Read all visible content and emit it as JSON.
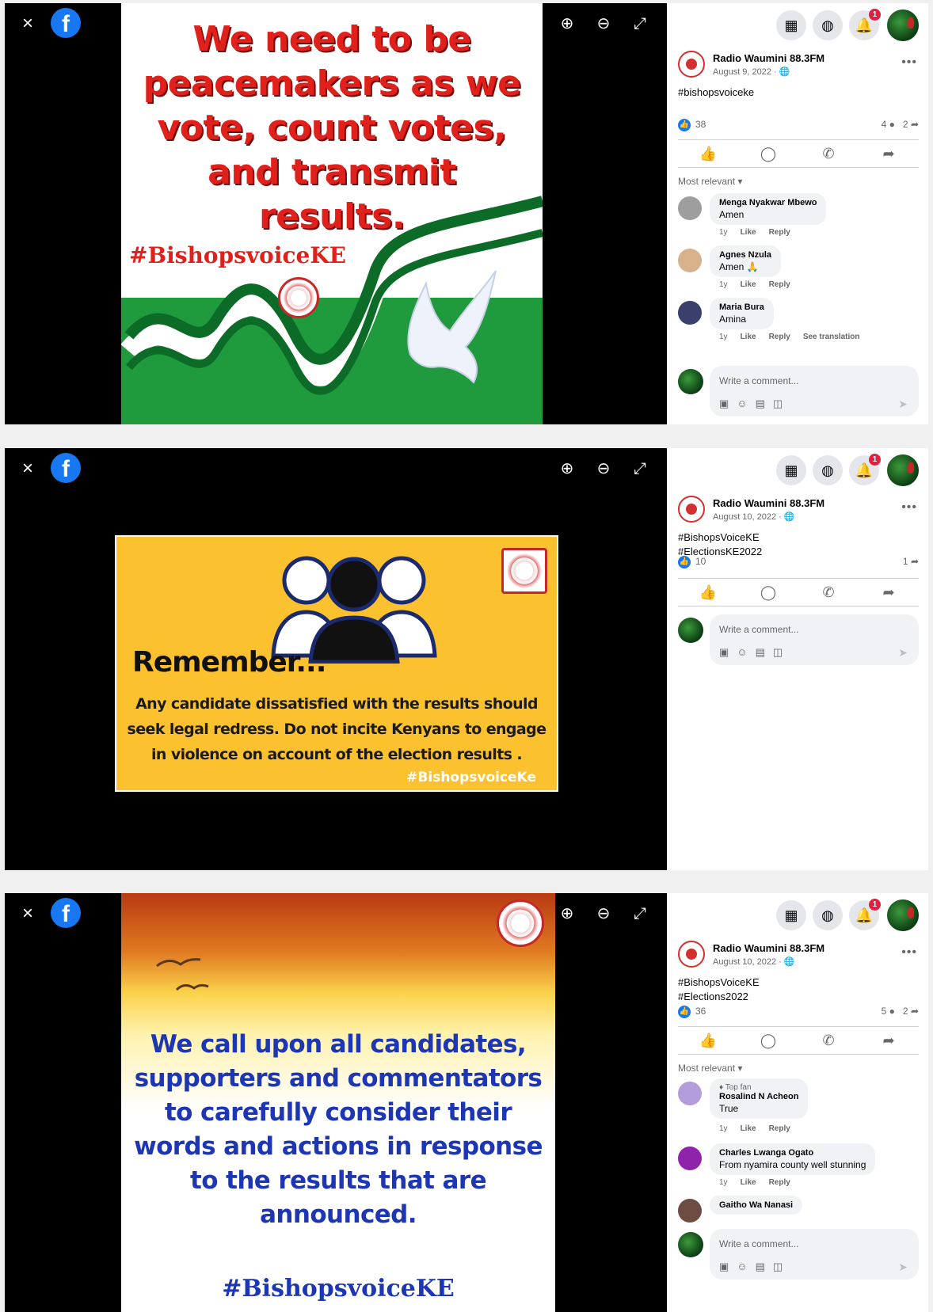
{
  "common": {
    "close_glyph": "×",
    "fb_logo": "f",
    "zoom_in_icon": "zoom-in-icon",
    "zoom_out_icon": "zoom-out-icon",
    "fullscreen_icon": "fullscreen-icon",
    "notification_count": "1",
    "page_name": "Radio Waumini 88.3FM",
    "reply_label": "Reply",
    "like_label": "Like",
    "comment_placeholder": "Write a comment...",
    "brand_blue": "#1877f2"
  },
  "posts": [
    {
      "image_text": "We need to be peacemakers as we vote, count votes, and transmit results.",
      "image_hashtag": "#BishopsvoiceKE",
      "date": "August 9, 2022 · ",
      "caption": "#bishopsvoiceke",
      "likes": "38",
      "comments_count": "4",
      "shares_count": "2",
      "sort_label": "Most relevant ▾",
      "comments": [
        {
          "name": "Menga Nyakwar Mbewo",
          "text": "Amen",
          "time": "1y",
          "extra": ""
        },
        {
          "name": "Agnes Nzula",
          "text": "Amen 🙏",
          "time": "1y",
          "extra": ""
        },
        {
          "name": "Maria Bura",
          "text": "Amina",
          "time": "1y",
          "extra": "See translation"
        }
      ]
    },
    {
      "image_heading": "Remember...",
      "image_text": "Any candidate dissatisfied with the results should seek legal redress. Do not incite Kenyans to engage in violence on account of the election results .",
      "image_hashtag": "#BishopsvoiceKe",
      "date": "August 10, 2022 · ",
      "caption_line1": "#BishopsVoiceKE",
      "caption_line2": "#ElectionsKE2022",
      "likes": "10",
      "shares_count": "1"
    },
    {
      "image_text": "We call upon all candidates, supporters and commentators to carefully consider their words and actions in response to the results that are announced.",
      "image_hashtag": "#BishopsvoiceKE",
      "date": "August 10, 2022 · ",
      "caption_line1": "#BishopsVoiceKE",
      "caption_line2": "#Elections2022",
      "likes": "36",
      "comments_count": "5",
      "shares_count": "2",
      "sort_label": "Most relevant ▾",
      "comments": [
        {
          "top": "Top fan",
          "name": "Rosalind N Acheon",
          "text": "True",
          "time": "1y"
        },
        {
          "name": "Charles Lwanga Ogato",
          "text": "From nyamira county well stunning",
          "time": "1y"
        },
        {
          "name": "Gaitho Wa Nanasi",
          "text": "",
          "time": ""
        }
      ]
    }
  ]
}
